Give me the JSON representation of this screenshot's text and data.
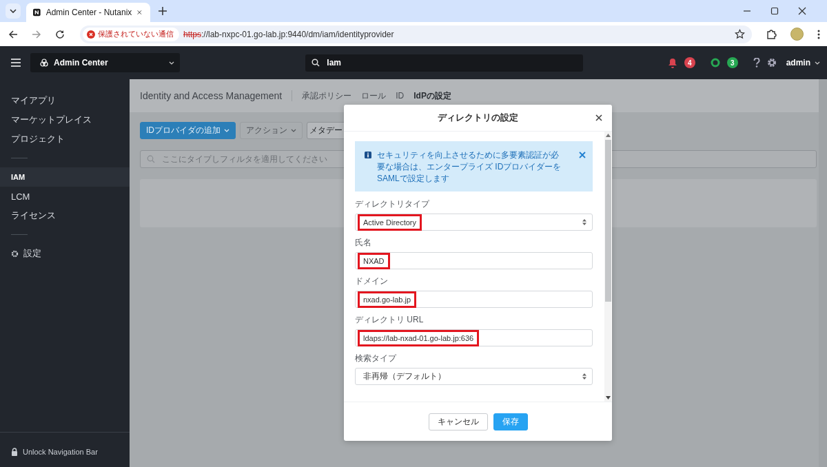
{
  "browser": {
    "tab_title": "Admin Center - Nutanix",
    "security_label": "保護されていない通信",
    "url_scheme": "https",
    "url_rest": "://lab-nxpc-01.go-lab.jp:9440/dm/iam/identityprovider"
  },
  "header": {
    "app_name": "Admin Center",
    "search_value": "Iam",
    "alerts": [
      {
        "kind": "bell",
        "count": "4",
        "color": "#d9434f"
      },
      {
        "kind": "ring",
        "count": "3",
        "color": "#27a853"
      }
    ],
    "user": "admin"
  },
  "sidebar": {
    "sections": [
      {
        "items": [
          {
            "label": "マイアプリ",
            "kind": "link",
            "selected": false
          },
          {
            "label": "マーケットプレイス",
            "kind": "link",
            "selected": false
          },
          {
            "label": "プロジェクト",
            "kind": "link",
            "selected": false
          }
        ]
      },
      {
        "items": [
          {
            "label": "IAM",
            "kind": "link",
            "selected": true
          },
          {
            "label": "LCM",
            "kind": "link",
            "selected": false
          },
          {
            "label": "ライセンス",
            "kind": "link",
            "selected": false
          }
        ]
      },
      {
        "items": [
          {
            "label": "設定",
            "kind": "settings",
            "selected": false
          }
        ]
      }
    ],
    "footer": "Unlock Navigation Bar"
  },
  "page": {
    "title": "Identity and Access Management",
    "tabs": [
      {
        "label": "承認ポリシー",
        "selected": false
      },
      {
        "label": "ロール",
        "selected": false
      },
      {
        "label": "ID",
        "selected": false
      },
      {
        "label": "IdPの設定",
        "selected": true
      }
    ],
    "toolbar": [
      {
        "label": "IDプロバイダの追加",
        "kind": "primary"
      },
      {
        "label": "アクション",
        "kind": "disabled"
      },
      {
        "label": "メタデー",
        "kind": "default"
      }
    ],
    "filter_placeholder": "ここにタイプしフィルタを適用してください"
  },
  "dialog": {
    "title": "ディレクトリの設定",
    "notice": "セキュリティを向上させるために多要素認証が必要な場合は、エンタープライズ IDプロバイダーをSAMLで設定します",
    "fields": [
      {
        "label": "ディレクトリタイプ",
        "value": "Active Directory",
        "kind": "select",
        "highlighted": true
      },
      {
        "label": "氏名",
        "value": "NXAD",
        "kind": "text",
        "highlighted": true
      },
      {
        "label": "ドメイン",
        "value": "nxad.go-lab.jp",
        "kind": "text",
        "highlighted": true
      },
      {
        "label": "ディレクトリ URL",
        "value": "ldaps://lab-nxad-01.go-lab.jp:636",
        "kind": "text",
        "highlighted": true
      },
      {
        "label": "検索タイプ",
        "value": "非再帰（デフォルト）",
        "kind": "select",
        "highlighted": false
      }
    ],
    "buttons": [
      {
        "label": "キャンセル",
        "kind": "secondary"
      },
      {
        "label": "保存",
        "kind": "primary"
      }
    ]
  }
}
